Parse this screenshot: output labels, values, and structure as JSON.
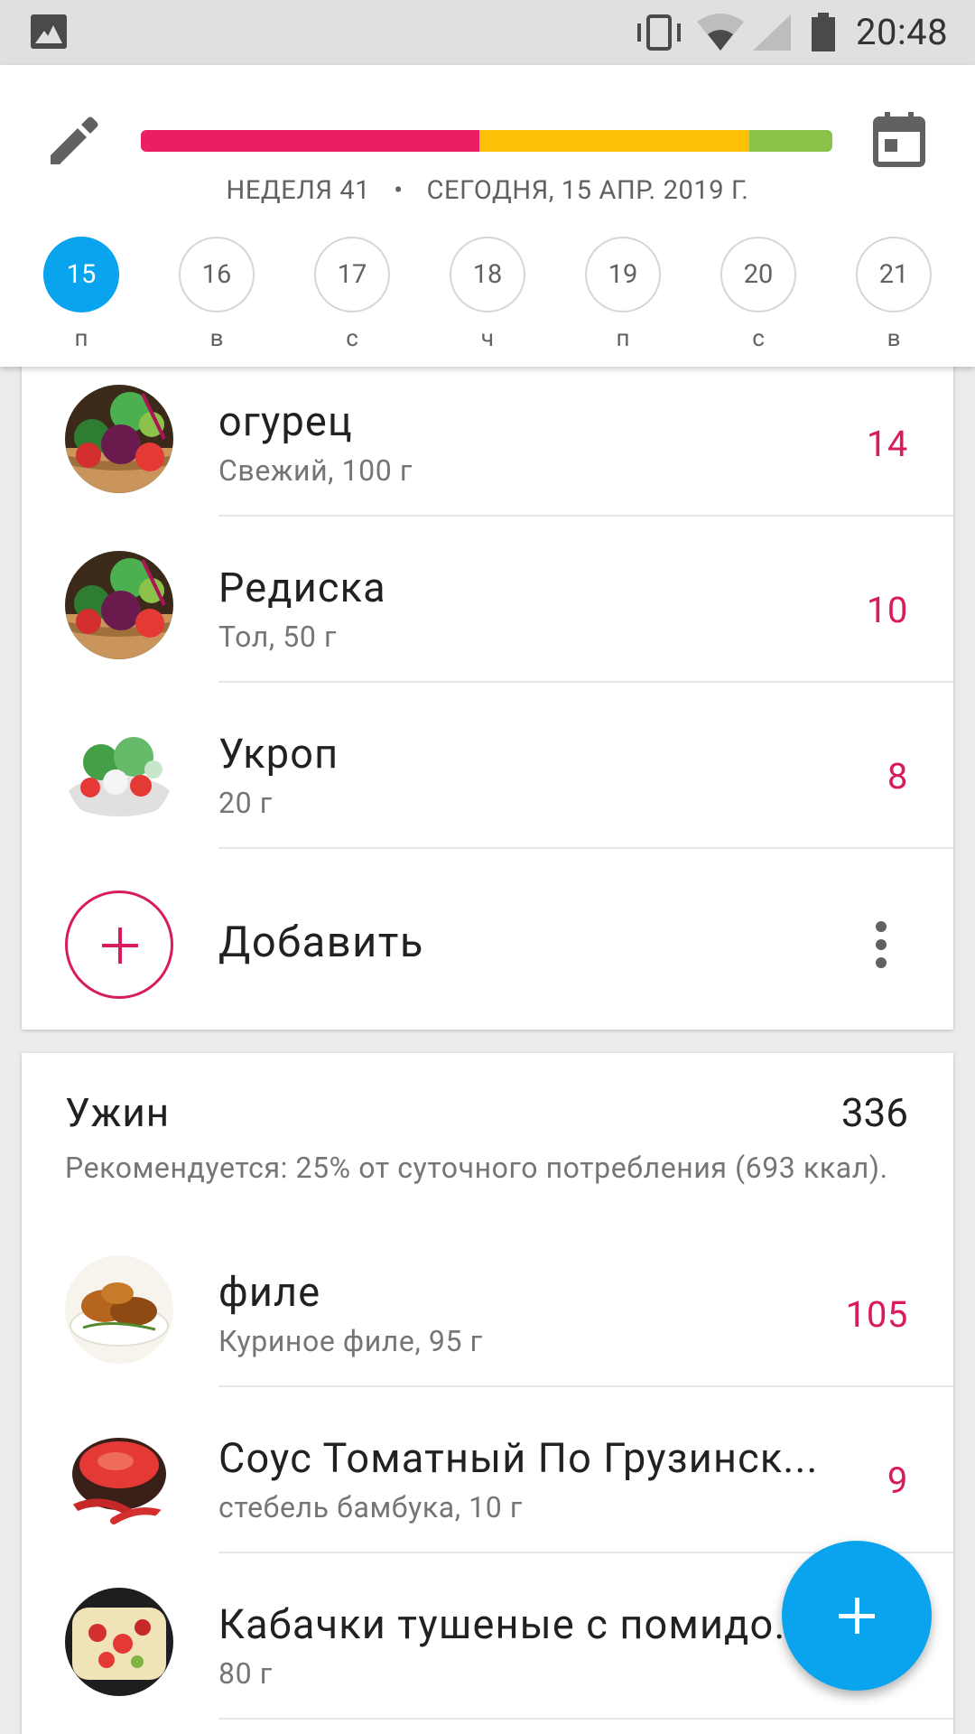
{
  "status_bar": {
    "time": "20:48"
  },
  "header": {
    "progress": [
      {
        "color": "#e91e63",
        "fraction": 0.49
      },
      {
        "color": "#ffc107",
        "fraction": 0.39
      },
      {
        "color": "#8bc34a",
        "fraction": 0.12
      }
    ],
    "week_label": "НЕДЕЛЯ 41",
    "separator": "•",
    "date_label": "СЕГОДНЯ, 15 АПР. 2019 Г.",
    "days": [
      {
        "num": "15",
        "name": "п",
        "active": true
      },
      {
        "num": "16",
        "name": "в",
        "active": false
      },
      {
        "num": "17",
        "name": "с",
        "active": false
      },
      {
        "num": "18",
        "name": "ч",
        "active": false
      },
      {
        "num": "19",
        "name": "п",
        "active": false
      },
      {
        "num": "20",
        "name": "с",
        "active": false
      },
      {
        "num": "21",
        "name": "в",
        "active": false
      }
    ]
  },
  "card1": {
    "items": [
      {
        "name": "огурец",
        "sub": "Свежий, 100 г",
        "kcal": "14",
        "thumb": "vegetables"
      },
      {
        "name": "Редиска",
        "sub": "Тол, 50 г",
        "kcal": "10",
        "thumb": "vegetables"
      },
      {
        "name": "Укроп",
        "sub": "20 г",
        "kcal": "8",
        "thumb": "salad"
      }
    ],
    "add_label": "Добавить"
  },
  "card2": {
    "title": "Ужин",
    "kcal": "336",
    "note": "Рекомендуется: 25% от суточного потребления (693 ккал).",
    "items": [
      {
        "name": "филе",
        "sub": "Куриное филе, 95 г",
        "kcal": "105",
        "thumb": "chicken"
      },
      {
        "name": "Соус Томатный По Грузинск...",
        "sub": "стебель бамбука, 10 г",
        "kcal": "9",
        "thumb": "sauce"
      },
      {
        "name": "Кабачки тушеные с помидорами",
        "sub": "80 г",
        "kcal": "",
        "thumb": "casserole"
      }
    ]
  }
}
